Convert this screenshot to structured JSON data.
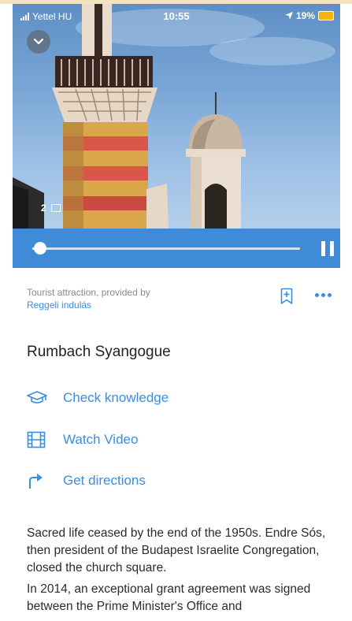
{
  "status_bar": {
    "carrier": "Yettel HU",
    "time": "10:55",
    "battery": "19%"
  },
  "hero": {
    "photo_count": "2"
  },
  "player": {
    "progress_fraction": 0.03
  },
  "attraction": {
    "category_text": "Tourist attraction, provided by",
    "provider": "Reggeli indulás",
    "title": "Rumbach Syangogue"
  },
  "actions": [
    {
      "label": "Check knowledge",
      "icon": "graduation-cap-icon"
    },
    {
      "label": "Watch Video",
      "icon": "film-icon"
    },
    {
      "label": "Get directions",
      "icon": "turn-right-arrow-icon"
    }
  ],
  "description": {
    "paragraph_1": "Sacred life ceased by the end of the 1950s. Endre Sós, then president of the Budapest Israelite Congregation, closed the church square.",
    "paragraph_2": "In 2014, an exceptional grant agreement was signed between the Prime Minister's Office and"
  },
  "colors": {
    "accent": "#3b8de0",
    "player_bar": "#3f8bd8"
  }
}
